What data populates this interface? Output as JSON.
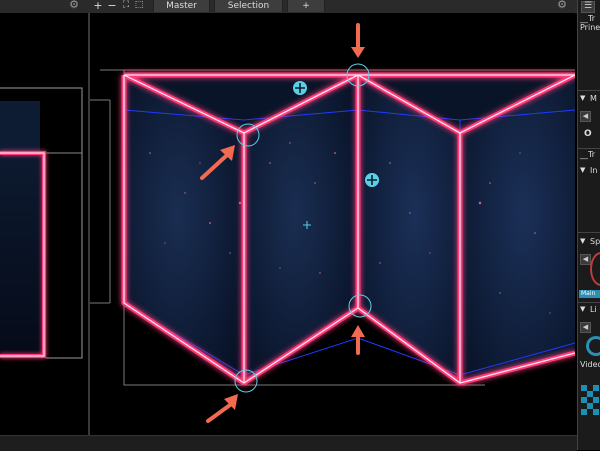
{
  "toolbar": {
    "buttons": [
      "+",
      "−",
      "⛶",
      "⬚"
    ],
    "tabs": [
      "Master",
      "Selection",
      "+"
    ],
    "gear_left": "⚙",
    "gear_right": "⚙"
  },
  "right_panel": {
    "menu_icon": "☰",
    "items": [
      "__Tr",
      "Prine",
      "M",
      "O",
      "__Tr",
      "In",
      "Sp",
      "Main",
      "Li",
      "Video"
    ]
  },
  "colors": {
    "neon_pink": "#ff3a7a",
    "neon_core": "#ffe6f0",
    "guide_blue": "#1f3bff",
    "annotation_arrow": "#f26a4f",
    "handle_cyan": "#5ad0e8",
    "accent_badge": "#2c8fb5"
  },
  "icons": {
    "move_handle": "move-handle-icon",
    "settings": "gear-icon",
    "menu": "menu-icon"
  }
}
